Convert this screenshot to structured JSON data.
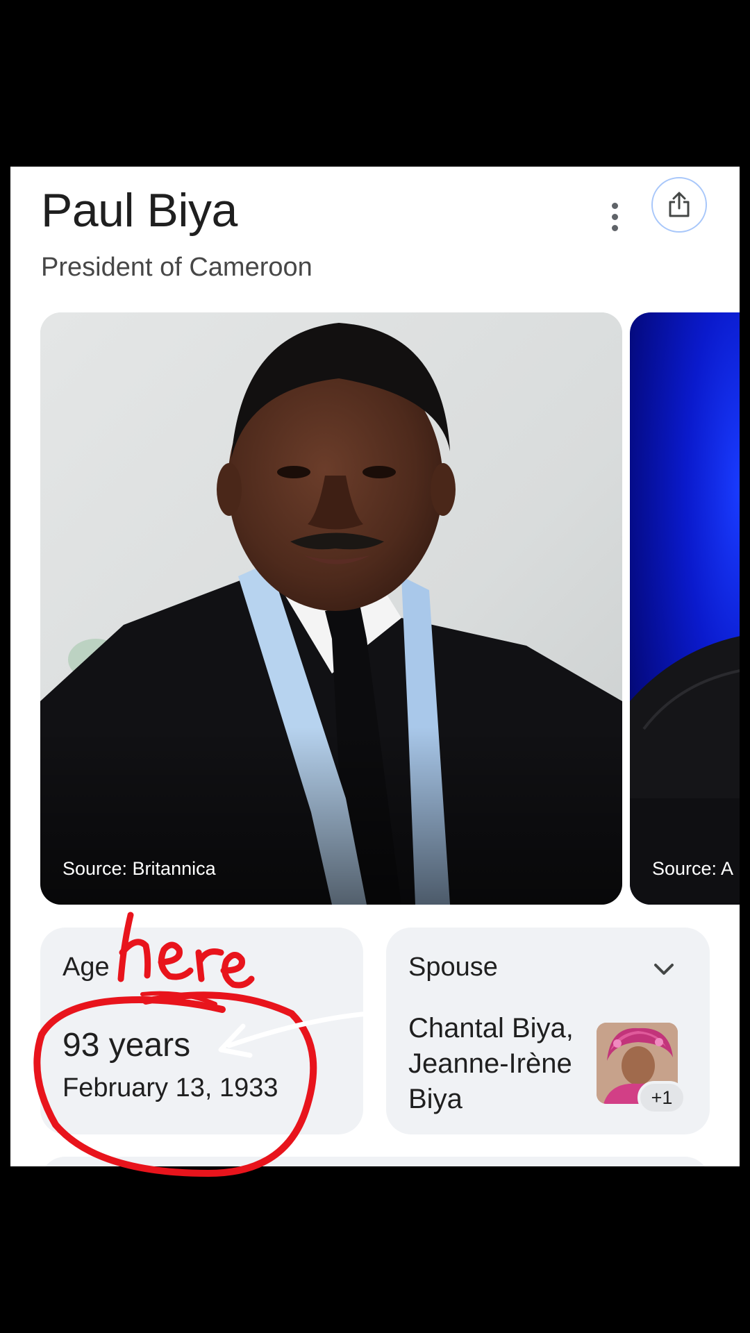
{
  "header": {
    "title": "Paul Biya",
    "subtitle": "President of Cameroon"
  },
  "images": [
    {
      "source": "Source: Britannica"
    },
    {
      "source": "Source: A"
    }
  ],
  "age": {
    "label": "Age",
    "value": "93 years",
    "date": "February 13, 1933"
  },
  "spouse": {
    "label": "Spouse",
    "names": "Chantal Biya, Jeanne-Irène Biya",
    "more_badge": "+1"
  },
  "annotation": {
    "text": "here",
    "color": "#e8141c"
  },
  "icons": {
    "more": "more-vert-icon",
    "share": "share-icon",
    "chevron": "chevron-down-icon"
  }
}
